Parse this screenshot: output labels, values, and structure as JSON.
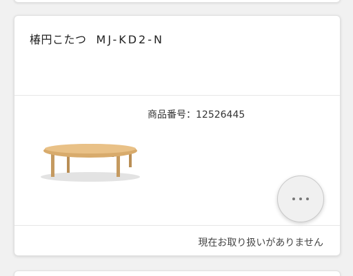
{
  "product": {
    "name": "椿円こたつ",
    "model": "MJ-KD2-N",
    "code_text": "商品番号：12526445",
    "status": "現在お取り扱いがありません",
    "image_icon": "low-round-kotatsu-table",
    "more_icon": "more-dots-icon"
  }
}
